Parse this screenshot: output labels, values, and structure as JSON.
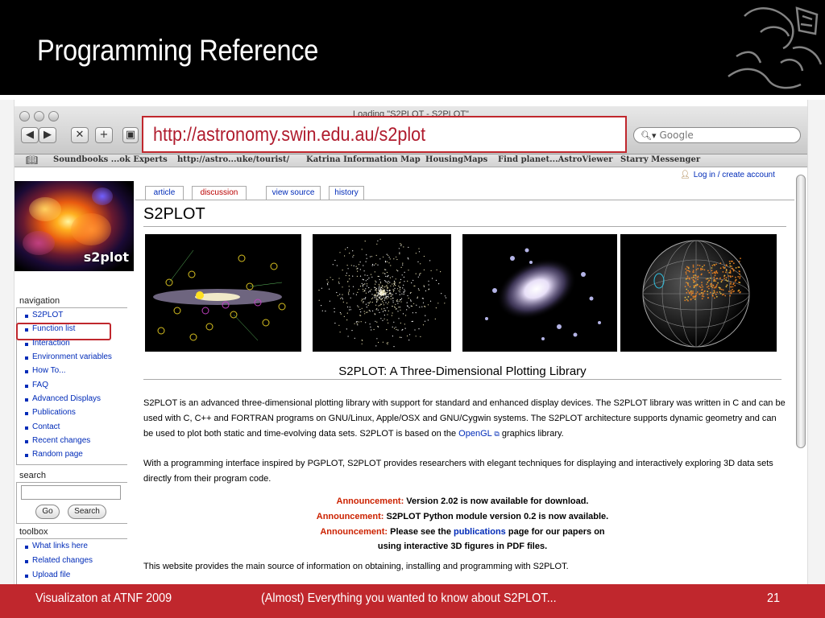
{
  "slide": {
    "title": "Programming Reference",
    "url_callout": "http://astronomy.swin.edu.au/s2plot",
    "footer_left": "Visualizaton at ATNF 2009",
    "footer_center": "(Almost) Everything you wanted to know about S2PLOT...",
    "footer_page": "21"
  },
  "browser": {
    "window_title": "Loading \"S2PLOT - S2PLOT\"",
    "buttons": {
      "back": "◀",
      "forward": "▶",
      "stop": "✕",
      "add": "+"
    },
    "search_placeholder": "Google",
    "bookmarks": [
      "Soundbooks ...ok Experts",
      "http://astro...uke/tourist/",
      "Katrina Information Map",
      "HousingMaps",
      "Find planet...AstroViewer",
      "Starry Messenger"
    ]
  },
  "wiki": {
    "login": "Log in / create account",
    "logo_text": "s2plot",
    "tabs": [
      "article",
      "discussion",
      "view source",
      "history"
    ],
    "page_title": "S2PLOT",
    "navigation": {
      "heading": "navigation",
      "items": [
        "S2PLOT",
        "Function list",
        "Interaction",
        "Environment variables",
        "How To...",
        "FAQ",
        "Advanced Displays",
        "Publications",
        "Contact",
        "Recent changes",
        "Random page"
      ]
    },
    "search": {
      "heading": "search",
      "go": "Go",
      "search": "Search"
    },
    "toolbox": {
      "heading": "toolbox",
      "items": [
        "What links here",
        "Related changes",
        "Upload file"
      ]
    },
    "subtitle": "S2PLOT: A Three-Dimensional Plotting Library",
    "intro": {
      "text_before": "S2PLOT is an advanced three-dimensional plotting library with support for standard and enhanced display devices. The S2PLOT library was written in C and can be used with C, C++ and FORTRAN programs on GNU/Linux, Apple/OSX and GNU/Cygwin systems. The S2PLOT architecture supports dynamic geometry and can be used to plot both static and time-evolving data sets. S2PLOT is based on the ",
      "link": "OpenGL",
      "text_after": " graphics library."
    },
    "interface": "With a programming interface inspired by PGPLOT, S2PLOT provides researchers with elegant techniques for displaying and interactively exploring 3D data sets directly from their program code.",
    "announcements": [
      {
        "label": "Announcement:",
        "text": " Version 2.02 is now available for download."
      },
      {
        "label": "Announcement:",
        "text": " S2PLOT Python module version 0.2 is now available."
      },
      {
        "label": "Announcement:",
        "text_before": " Please see the ",
        "link": "publications",
        "text_after": " page for our papers on"
      }
    ],
    "announce_cont": "using interactive 3D figures in PDF files.",
    "closing": "This website provides the main source of information on obtaining, installing and programming with S2PLOT."
  }
}
